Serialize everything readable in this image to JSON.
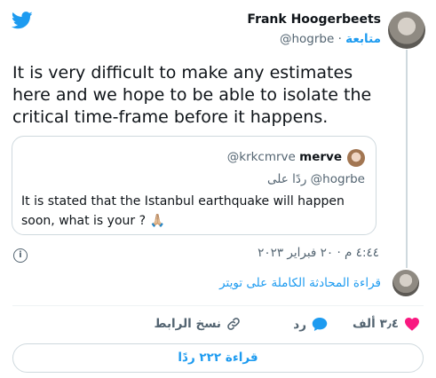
{
  "author": {
    "name": "Frank Hoogerbeets",
    "handle": "@hogrbe",
    "follow_label": "متابعة",
    "separator": "·"
  },
  "tweet": {
    "text": "It is stated that the Istanbul earthquake will happen soon, what is your ?"
  },
  "main_text": "It is very difficult to make any estimates here and we hope to be able to isolate the critical time-frame before it happens.",
  "quoted": {
    "name": "merve",
    "handle": "@krkcmrve",
    "reply_to": "ردًا على @hogrbe",
    "text": "It is stated that the Istanbul earthquake will happen soon, what is your ? 🙏🏼"
  },
  "timestamp": "٤:٤٤ م · ٢٠ فبراير ٢٠٢٣",
  "read_conversation": "قراءة المحادثة الكاملة على تويتر",
  "actions": {
    "likes": "٣٫٤ ألف",
    "reply": "رد",
    "copy_link": "نسخ الرابط"
  },
  "read_replies": "قراءة ٢٢٢ ردًا",
  "colors": {
    "accent": "#1d9bf0",
    "like": "#f91880",
    "muted": "#536471"
  },
  "icons": [
    "twitter-bird-icon",
    "info-icon",
    "heart-icon",
    "reply-icon",
    "link-icon"
  ]
}
